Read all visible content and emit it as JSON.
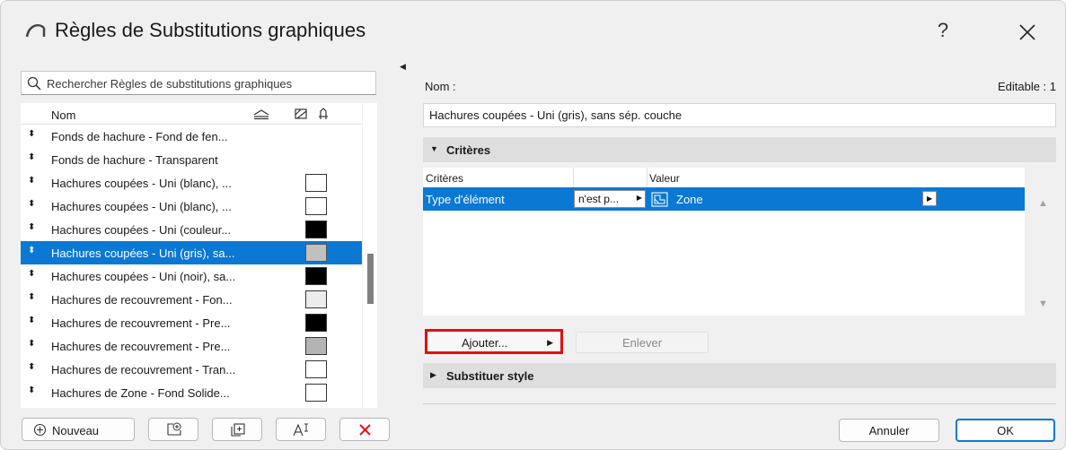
{
  "window": {
    "title": "Règles de Substitutions graphiques",
    "help_label": "?"
  },
  "search": {
    "placeholder": "Rechercher Règles de substitutions graphiques"
  },
  "list": {
    "header_name": "Nom",
    "items": [
      {
        "label": "Fonds de hachure  - Fond de fen...",
        "swatch": null,
        "selected": false
      },
      {
        "label": "Fonds de hachure  - Transparent",
        "swatch": null,
        "selected": false
      },
      {
        "label": "Hachures coupées - Uni (blanc), ...",
        "swatch": "#ffffff",
        "selected": false
      },
      {
        "label": "Hachures coupées - Uni (blanc), ...",
        "swatch": "#ffffff",
        "selected": false
      },
      {
        "label": "Hachures coupées - Uni (couleur...",
        "swatch": "#000000",
        "selected": false
      },
      {
        "label": "Hachures coupées - Uni (gris), sa...",
        "swatch": "#c0c0c0",
        "selected": true
      },
      {
        "label": "Hachures coupées - Uni (noir), sa...",
        "swatch": "#000000",
        "selected": false
      },
      {
        "label": "Hachures de recouvrement - Fon...",
        "swatch": "#ececec",
        "selected": false
      },
      {
        "label": "Hachures de recouvrement - Pre...",
        "swatch": "#000000",
        "selected": false
      },
      {
        "label": "Hachures de recouvrement - Pre...",
        "swatch": "#b4b4b4",
        "selected": false
      },
      {
        "label": "Hachures de recouvrement - Tran...",
        "swatch": "#ffffff",
        "selected": false
      },
      {
        "label": "Hachures de Zone - Fond Solide...",
        "swatch": "#ffffff",
        "selected": false
      }
    ]
  },
  "left_buttons": {
    "new_label": "Nouveau"
  },
  "details": {
    "name_label": "Nom :",
    "editable_label": "Editable : 1",
    "name_value": "Hachures coupées - Uni (gris), sans sép. couche"
  },
  "criteria": {
    "section_title": "Critères",
    "col_criteria": "Critères",
    "col_value": "Valeur",
    "row": {
      "criterion": "Type d'élément",
      "operator": "n'est p...",
      "value": "Zone"
    },
    "add_label": "Ajouter...",
    "remove_label": "Enlever"
  },
  "override": {
    "section_title": "Substituer style"
  },
  "footer": {
    "cancel_label": "Annuler",
    "ok_label": "OK"
  },
  "colors": {
    "accent": "#0b78d4",
    "highlight_border": "#e01010",
    "delete_red": "#e81123"
  }
}
